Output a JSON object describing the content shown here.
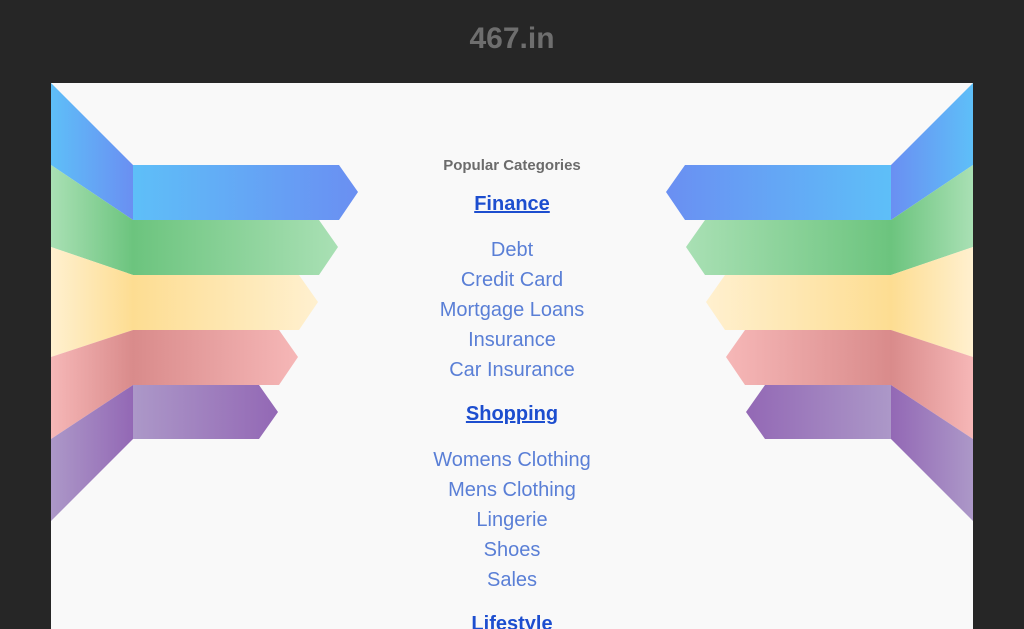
{
  "header": {
    "site_title": "467.in"
  },
  "main": {
    "popular_label": "Popular Categories",
    "categories": [
      {
        "heading": "Finance",
        "links": [
          "Debt",
          "Credit Card",
          "Mortgage Loans",
          "Insurance",
          "Car Insurance"
        ]
      },
      {
        "heading": "Shopping",
        "links": [
          "Womens Clothing",
          "Mens Clothing",
          "Lingerie",
          "Shoes",
          "Sales"
        ]
      },
      {
        "heading": "Lifestyle",
        "links": []
      }
    ]
  },
  "colors": {
    "page_bg": "#262626",
    "panel_bg": "#f9f9f9",
    "heading_link": "#1d4ecf",
    "link": "#5a7fd6",
    "ribbon_blue": "#66b8f5",
    "ribbon_green": "#7ccf8c",
    "ribbon_yellow": "#fde2a0",
    "ribbon_pink": "#e89a9a",
    "ribbon_purple": "#a07cc0"
  }
}
